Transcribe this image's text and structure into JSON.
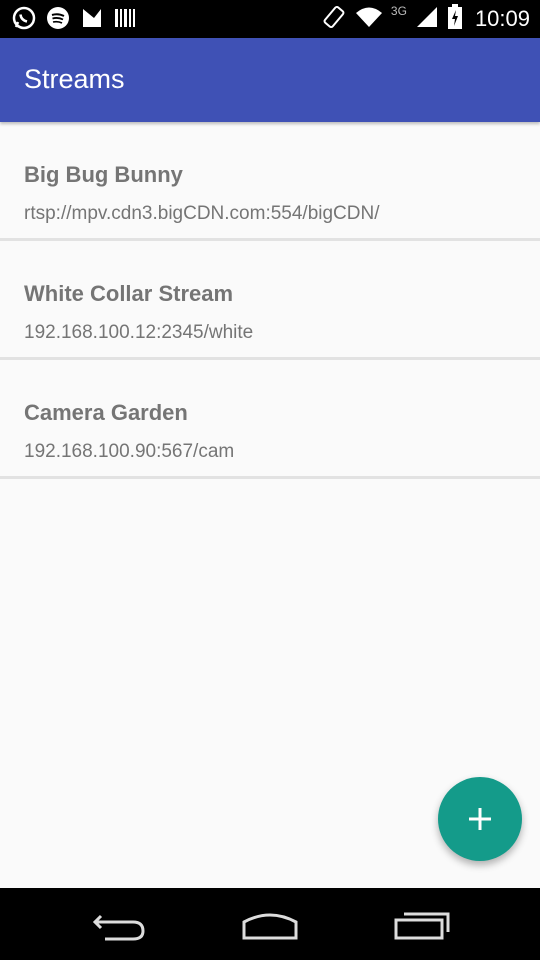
{
  "status_bar": {
    "time": "10:09",
    "network_type": "3G",
    "icons": [
      "whatsapp-icon",
      "spotify-icon",
      "tasker-icon",
      "barcode-icon",
      "rotate-icon",
      "wifi-icon",
      "signal-icon",
      "battery-icon"
    ]
  },
  "app_bar": {
    "title": "Streams"
  },
  "streams": [
    {
      "name": "Big Bug Bunny",
      "url": "rtsp://mpv.cdn3.bigCDN.com:554/bigCDN/"
    },
    {
      "name": "White Collar Stream",
      "url": "192.168.100.12:2345/white"
    },
    {
      "name": "Camera Garden",
      "url": "192.168.100.90:567/cam"
    }
  ],
  "fab": {
    "icon": "add-icon",
    "color": "#149b8a"
  },
  "colors": {
    "primary": "#3f51b5",
    "accent": "#149b8a",
    "text_secondary": "#757575"
  },
  "nav_bar": {
    "icons": [
      "back-icon",
      "home-icon",
      "recents-icon"
    ]
  }
}
